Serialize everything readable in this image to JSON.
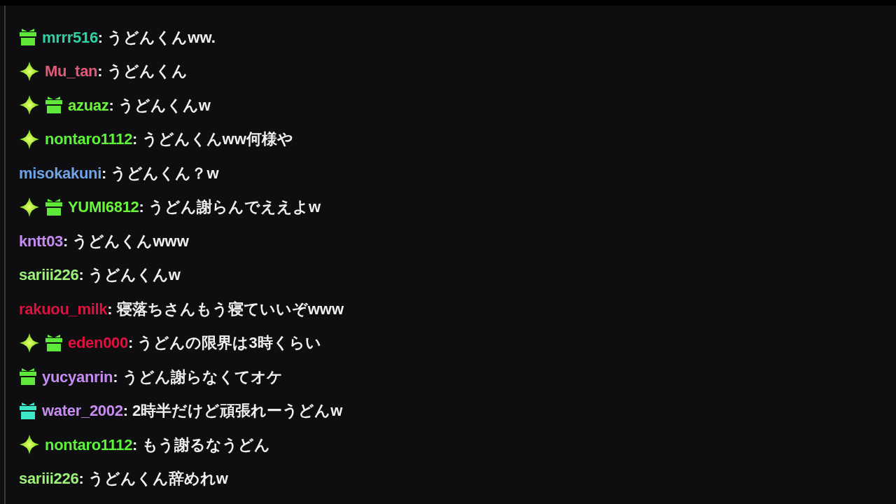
{
  "messages": [
    {
      "badges": [
        {
          "kind": "gift",
          "color": "#5ee83a"
        }
      ],
      "user": "mrrr516",
      "color": "#2ed3a0",
      "text": ": うどんくんww."
    },
    {
      "badges": [
        {
          "kind": "sparkle"
        }
      ],
      "user": "Mu_tan",
      "color": "#e05a7a",
      "text": ": うどんくん"
    },
    {
      "badges": [
        {
          "kind": "sparkle"
        },
        {
          "kind": "gift",
          "color": "#5ee83a"
        }
      ],
      "user": "azuaz",
      "color": "#6af53a",
      "text": ": うどんくんw"
    },
    {
      "badges": [
        {
          "kind": "sparkle"
        }
      ],
      "user": "nontaro1112",
      "color": "#5ef23a",
      "text": ": うどんくんww何様や"
    },
    {
      "user": "misokakuni",
      "color": "#6fa3e6",
      "text": ": うどんくん？w"
    },
    {
      "badges": [
        {
          "kind": "sparkle"
        },
        {
          "kind": "gift",
          "color": "#5ee83a"
        }
      ],
      "user": "YUMI6812",
      "color": "#6af53a",
      "text": ": うどん謝らんでええよw"
    },
    {
      "user": "kntt03",
      "color": "#c78cf2",
      "text": ": うどんくんwww"
    },
    {
      "user": "sariii226",
      "color": "#9df07a",
      "text": ": うどんくんw"
    },
    {
      "user": "rakuou_milk",
      "color": "#e0103f",
      "text": ": 寝落ちさんもう寝ていいぞwww"
    },
    {
      "badges": [
        {
          "kind": "sparkle"
        },
        {
          "kind": "gift",
          "color": "#5ee83a"
        }
      ],
      "user": "eden000",
      "color": "#e0103f",
      "text": ": うどんの限界は3時くらい"
    },
    {
      "badges": [
        {
          "kind": "gift",
          "color": "#5ee83a"
        }
      ],
      "user": "yucyanrin",
      "color": "#c78cf2",
      "text": ": うどん謝らなくてオケ"
    },
    {
      "badges": [
        {
          "kind": "gift",
          "color": "#3ee6c8"
        }
      ],
      "user": "water_2002",
      "color": "#c98cf0",
      "text": ": 2時半だけど頑張れーうどんw"
    },
    {
      "badges": [
        {
          "kind": "sparkle"
        }
      ],
      "user": "nontaro1112",
      "color": "#5ef23a",
      "text": ": もう謝るなうどん"
    },
    {
      "user": "sariii226",
      "color": "#9df07a",
      "text": ": うどんくん辞めれw"
    }
  ]
}
